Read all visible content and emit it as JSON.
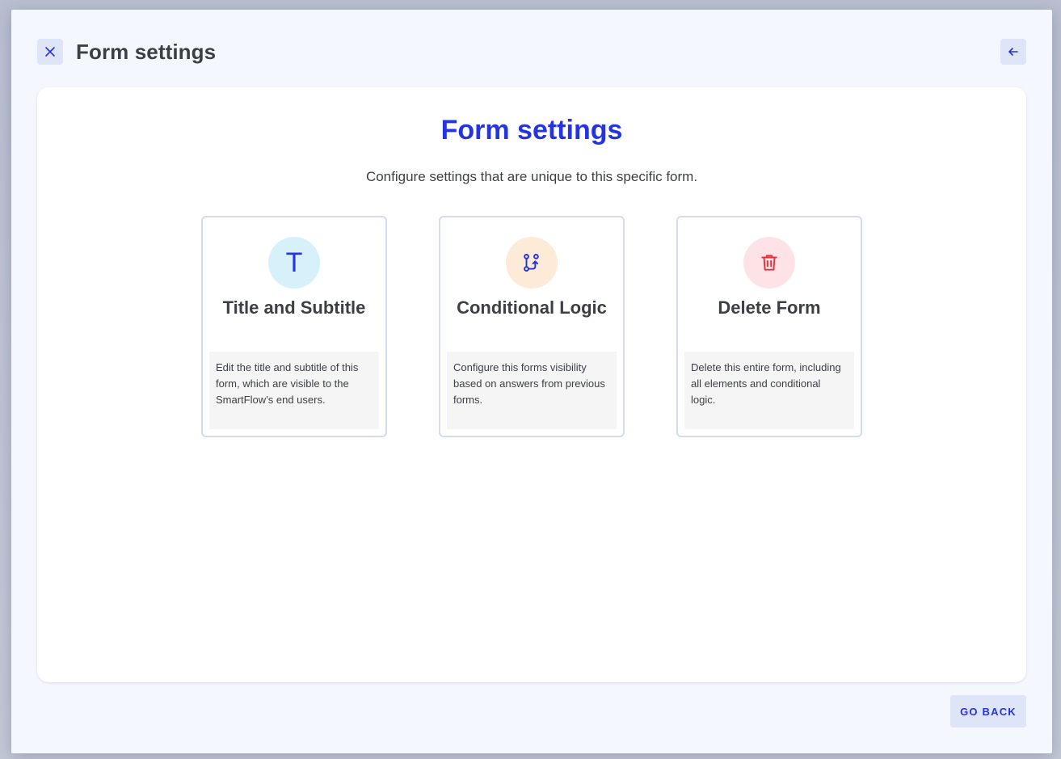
{
  "header": {
    "title": "Form settings",
    "close_icon": "close-icon",
    "back_icon": "arrow-left-icon"
  },
  "main": {
    "title": "Form settings",
    "subtitle": "Configure settings that are unique to this specific form.",
    "options": [
      {
        "badge_letter": "T",
        "icon": "text-t-icon",
        "title": "Title and Subtitle",
        "description": "Edit the title and subtitle of this form, which are visible to the SmartFlow’s end users."
      },
      {
        "icon": "branch-icon",
        "title": "Conditional Logic",
        "description": "Configure this forms visibility based on answers from previous forms."
      },
      {
        "icon": "trash-icon",
        "title": "Delete Form",
        "description": "Delete this entire form, including all elements and conditional logic."
      }
    ]
  },
  "footer": {
    "go_back_label": "GO BACK"
  },
  "colors": {
    "accent": "#2434e0",
    "delete": "#e0343f",
    "text": "#3d3f47",
    "modal_bg": "#f4f7fd"
  }
}
